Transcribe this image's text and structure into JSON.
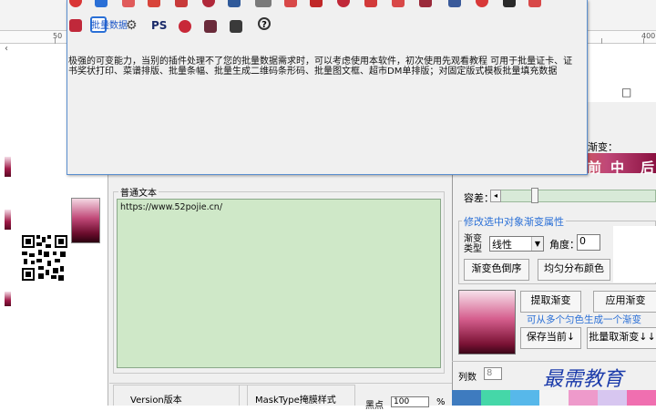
{
  "canvas": {
    "ruler_marks": [
      "50",
      "400"
    ],
    "scroll_glyph": "‹"
  },
  "dialog": {
    "toolbar_row2_label": "批量数据",
    "ps_label": "PS",
    "description": "极强的可变能力，当别的插件处理不了您的批量数据需求时，可以考虑使用本软件，初次使用先观看教程 可用于批量证卡、证书奖状打印、菜谱排版、批量条幅、批量生成二维码条形码、批量图文框、超市DM单排版；对固定版式模板批量填充数据"
  },
  "text_panel": {
    "group_label": "普通文本",
    "content": "https://www.52pojie.cn/",
    "version_label": "Version版本",
    "masktype_label": "MaskType掩膜样式",
    "blackpoint_label": "黑点",
    "blackpoint_value": "100",
    "percent": "%"
  },
  "gradient_panel": {
    "gradient_label": "渐变：",
    "bar_chars": [
      "前",
      "中",
      "后"
    ],
    "tolerance_label": "容差：",
    "modify_group_title": "修改选中对象渐变属性",
    "gradient_type_label": "渐变类型",
    "gradient_type_value": "线性",
    "angle_label": "角度：",
    "angle_value": "0",
    "reverse_button": "渐变色倒序",
    "even_button": "均匀分布颜色",
    "extract_button": "提取渐变",
    "apply_button": "应用渐变",
    "hint": "可从多个匀色生成一个渐变",
    "save_current_button": "保存当前↓",
    "batch_extract_button": "批量取渐变↓↓",
    "columns_label": "列数",
    "columns_value": "8",
    "maximize_glyph": "□"
  },
  "watermark": "最需教育",
  "colors": {
    "accent_blue": "#2a6fd6",
    "text_area_bg": "#cfe8c8",
    "gradient_dark": "#7a1234"
  }
}
